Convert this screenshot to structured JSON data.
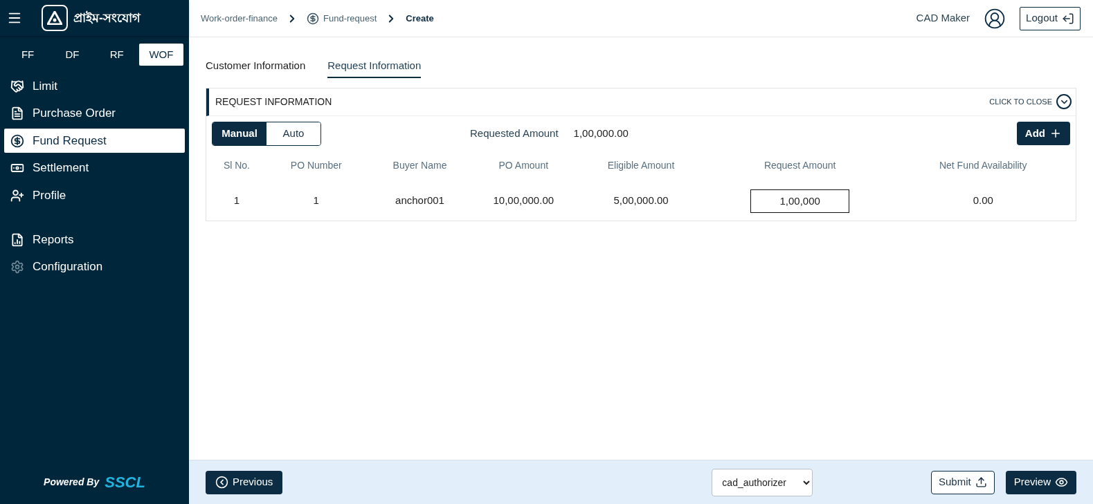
{
  "brand": {
    "name": "প্রাইম-সংযোগ"
  },
  "product_tabs": [
    {
      "label": "FF",
      "selected": false
    },
    {
      "label": "DF",
      "selected": false
    },
    {
      "label": "RF",
      "selected": false
    },
    {
      "label": "WOF",
      "selected": true
    }
  ],
  "sidebar": {
    "items": [
      {
        "label": "Limit",
        "selected": false
      },
      {
        "label": "Purchase Order",
        "selected": false
      },
      {
        "label": "Fund Request",
        "selected": true
      },
      {
        "label": "Settlement",
        "selected": false
      },
      {
        "label": "Profile",
        "selected": false
      }
    ],
    "secondary_items": [
      {
        "label": "Reports",
        "selected": false
      },
      {
        "label": "Configuration",
        "selected": false
      }
    ],
    "footer": {
      "label": "Powered By",
      "brand": "SSCL"
    }
  },
  "breadcrumb": [
    {
      "label": "Work-order-finance",
      "current": false
    },
    {
      "label": "Fund-request",
      "current": false
    },
    {
      "label": "Create",
      "current": true
    }
  ],
  "user": {
    "name": "CAD Maker"
  },
  "logout": {
    "label": "Logout"
  },
  "tabs": [
    {
      "label": "Customer Information",
      "selected": false
    },
    {
      "label": "Request Information",
      "selected": true
    }
  ],
  "panel": {
    "title": "REQUEST INFORMATION",
    "close_label": "CLICK TO CLOSE",
    "mode_toggle": [
      {
        "label": "Manual",
        "selected": true
      },
      {
        "label": "Auto",
        "selected": false
      }
    ],
    "requested_amount": {
      "label": "Requested Amount",
      "value": "1,00,000.00"
    },
    "add_button": {
      "label": "Add"
    },
    "table": {
      "columns": [
        "Sl No.",
        "PO Number",
        "Buyer Name",
        "PO Amount",
        "Eligible Amount",
        "Request Amount",
        "Net Fund Availability"
      ],
      "rows": [
        {
          "cells": [
            {
              "kind": "text",
              "value": "1"
            },
            {
              "kind": "text",
              "value": "1"
            },
            {
              "kind": "text",
              "value": "anchor001"
            },
            {
              "kind": "text",
              "value": "10,00,000.00"
            },
            {
              "kind": "text",
              "value": "5,00,000.00"
            },
            {
              "kind": "input",
              "value": "1,00,000"
            },
            {
              "kind": "text",
              "value": "0.00"
            }
          ]
        }
      ]
    }
  },
  "footer": {
    "previous": {
      "label": "Previous"
    },
    "authorizer": {
      "value": "cad_authorizer"
    },
    "submit": {
      "label": "Submit"
    },
    "preview": {
      "label": "Preview"
    }
  }
}
